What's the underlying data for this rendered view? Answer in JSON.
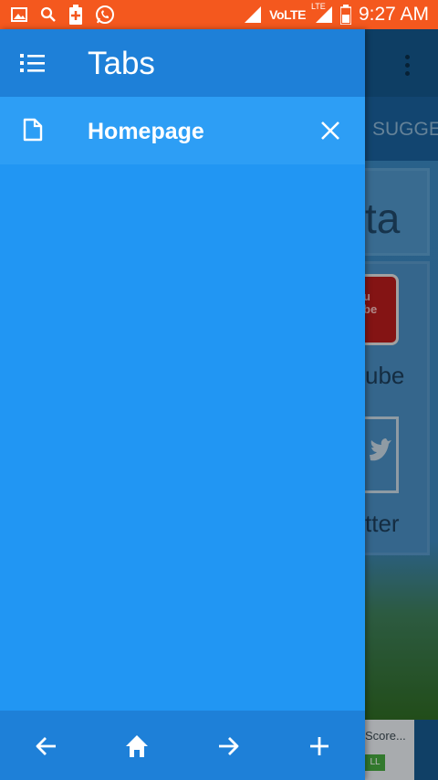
{
  "status_bar": {
    "time": "9:27 AM",
    "network": "VoLTE",
    "network_badge": "LTE",
    "icons": [
      "gallery-icon",
      "search-icon",
      "battery-saver-icon",
      "whatsapp-icon",
      "signal-icon",
      "battery-icon"
    ],
    "background_color": "#f4581e"
  },
  "drawer": {
    "title": "Tabs",
    "header_icon": "tab-list-icon",
    "tabs": [
      {
        "title": "Homepage",
        "icon": "page-icon",
        "close_icon": "close-icon"
      }
    ],
    "bottom_bar": {
      "buttons": [
        {
          "name": "back-button",
          "icon": "arrow-left-icon"
        },
        {
          "name": "home-button",
          "icon": "home-icon"
        },
        {
          "name": "forward-button",
          "icon": "arrow-right-icon"
        },
        {
          "name": "new-tab-button",
          "icon": "plus-icon"
        }
      ]
    },
    "colors": {
      "background": "#2196f3",
      "header": "#1e80d8",
      "selected_tab": "#2d9ef5"
    }
  },
  "background_page": {
    "tab_bar_partial": "SUGGE",
    "card_partial_text": "ta",
    "youtube_icon_text": "u\nbe",
    "youtube_label_partial": "ube",
    "twitter_label_partial": "tter",
    "score_text_partial": "Score...",
    "score_button_partial": "LL"
  }
}
